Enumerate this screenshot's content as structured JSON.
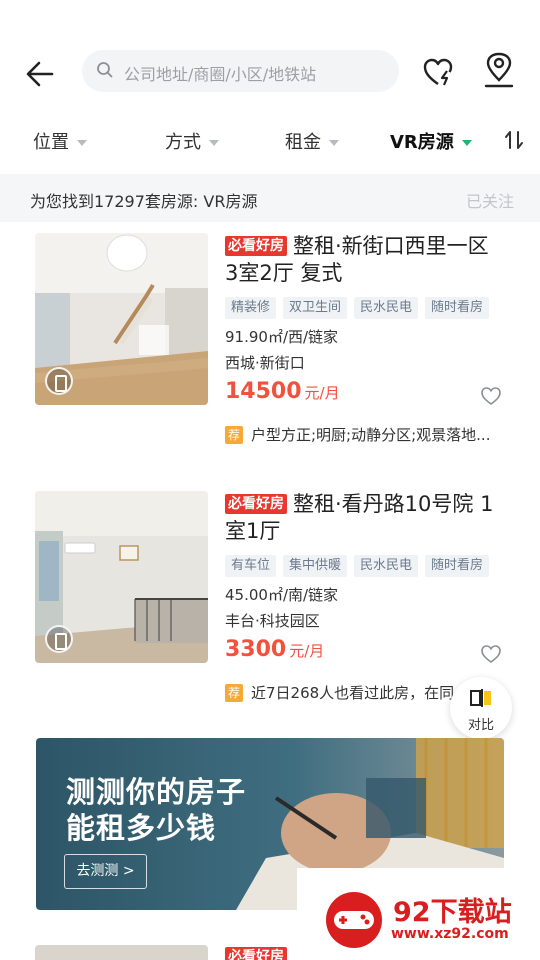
{
  "search": {
    "placeholder": "公司地址/商圈/小区/地铁站"
  },
  "icons": {
    "back": "arrow-left-icon",
    "search": "search-icon",
    "favorite": "heart-flash-icon",
    "location": "location-pin-icon",
    "sort": "sort-arrows-icon"
  },
  "filters": [
    {
      "label": "位置",
      "active": false
    },
    {
      "label": "方式",
      "active": false
    },
    {
      "label": "租金",
      "active": false
    },
    {
      "label": "VR房源",
      "active": true
    }
  ],
  "result": {
    "text": "为您找到17297套房源: VR房源",
    "follow": "已关注"
  },
  "listings": [
    {
      "badge": "必看好房",
      "title": "整租·新街口西里一区 3室2厅 复式",
      "tags": [
        "精装修",
        "双卫生间",
        "民水民电",
        "随时看房"
      ],
      "area": "91.90㎡/西/链家",
      "location": "西城·新街口",
      "price": "14500",
      "price_unit": "元/月",
      "reco_mark": "荐",
      "reco": "户型方正;明厨;动静分区;观景落地..."
    },
    {
      "badge": "必看好房",
      "title": "整租·看丹路10号院 1室1厅",
      "tags": [
        "有车位",
        "集中供暖",
        "民水民电",
        "随时看房"
      ],
      "area": "45.00㎡/南/链家",
      "location": "丰台·科技园区",
      "price": "3300",
      "price_unit": "元/月",
      "reco_mark": "荐",
      "reco": "近7日268人也看过此房，在同"
    }
  ],
  "compare": {
    "label": "对比"
  },
  "banner": {
    "line1": "测测你的房子",
    "line2": "能租多少钱",
    "button": "去测测 >"
  },
  "peek": {
    "badge": "必看好房"
  },
  "watermark": {
    "name": "92下载站",
    "url": "www.xz92.com"
  },
  "colors": {
    "accent": "#20b573",
    "price": "#f2513e",
    "must_badge": "#e8372f",
    "reco": "#f7a935"
  }
}
